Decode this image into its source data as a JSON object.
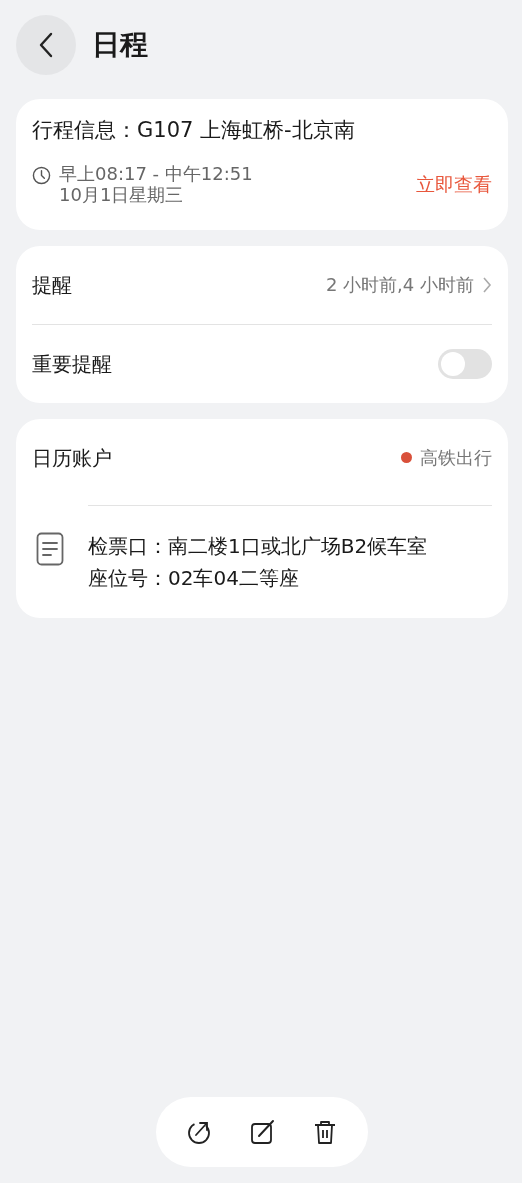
{
  "header": {
    "title": "日程"
  },
  "trip_card": {
    "title": "行程信息：G107 上海虹桥-北京南",
    "time": "早上08:17 - 中午12:51",
    "date": "10月1日星期三",
    "action": "立即查看"
  },
  "reminder_card": {
    "reminder": {
      "label": "提醒",
      "value": "2 小时前,4 小时前"
    },
    "important": {
      "label": "重要提醒",
      "on": false
    }
  },
  "account_card": {
    "label": "日历账户",
    "calendar": {
      "name": "高铁出行",
      "color": "#d9503a"
    },
    "notes": [
      "检票口：南二楼1口或北广场B2候车室",
      "座位号：02车04二等座"
    ]
  }
}
